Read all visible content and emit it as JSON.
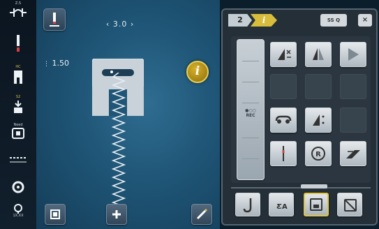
{
  "left_strip": {
    "items": [
      {
        "label": "Z.S",
        "icon": "stitch-pattern-icon"
      },
      {
        "label": "",
        "icon": "needle-icon"
      },
      {
        "label": "HC",
        "icon": "presser-foot-icon"
      },
      {
        "label": "S2",
        "icon": "foot-pressure-icon"
      },
      {
        "label": "Need",
        "icon": "needle-plate-icon"
      },
      {
        "label": "",
        "icon": "stitch-row-icon"
      },
      {
        "label": "",
        "icon": "tension-icon"
      },
      {
        "label": "1X.XX",
        "icon": "thread-icon"
      }
    ]
  },
  "main": {
    "stitch_width": "‹ 3.0 ›",
    "stitch_length": "1.50",
    "info_button_label": "i"
  },
  "panel": {
    "tab_number": "2",
    "tab_info": "i",
    "search_label": "SS Q",
    "close_label": "×",
    "rec_label": "REC"
  }
}
